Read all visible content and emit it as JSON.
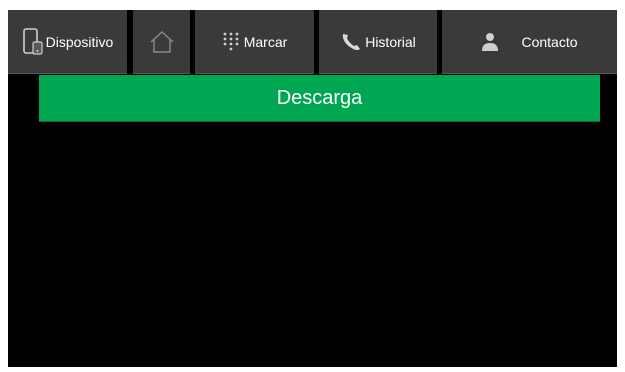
{
  "tabs": {
    "device": {
      "label": "Dispositivo",
      "icon": "device-icon"
    },
    "home": {
      "icon": "home-icon"
    },
    "dial": {
      "label": "Marcar",
      "icon": "keypad-icon"
    },
    "history": {
      "label": "Historial",
      "icon": "phone-icon"
    },
    "contact": {
      "label": "Contacto",
      "icon": "person-icon"
    }
  },
  "banner": {
    "title": "Descarga",
    "color": "#00a651"
  },
  "colors": {
    "tab_bg": "#3a3a3a",
    "screen_bg": "#000000",
    "text": "#ffffff"
  }
}
